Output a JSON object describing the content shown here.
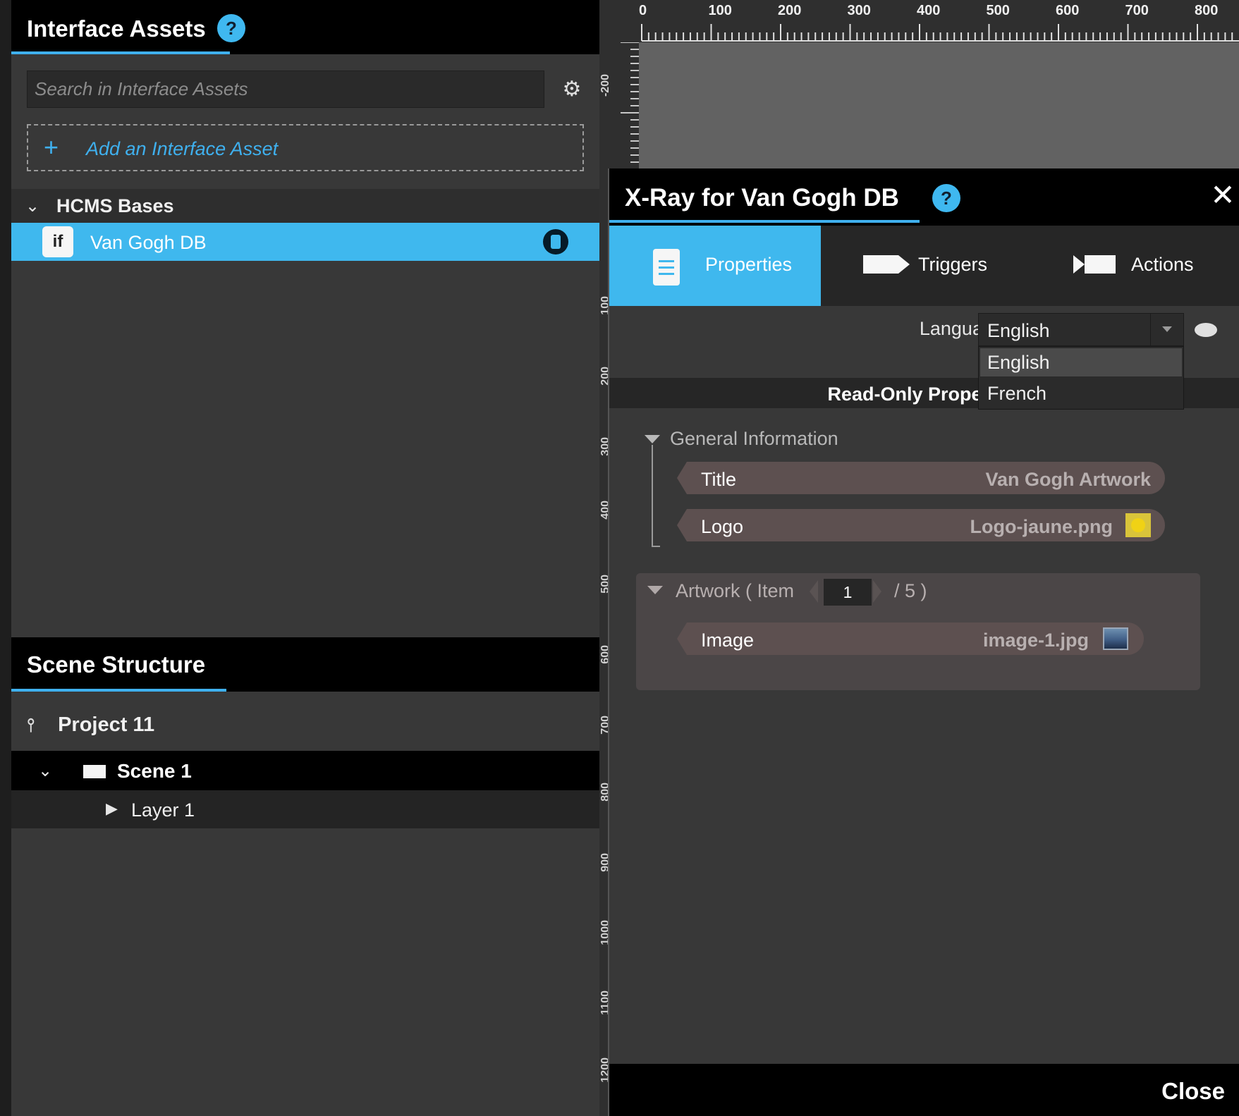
{
  "left_panel": {
    "interface_assets": {
      "title": "Interface Assets",
      "help": "?",
      "search_placeholder": "Search in Interface Assets",
      "add_label": "Add an Interface Asset",
      "add_icon": "+",
      "group": {
        "label": "HCMS Bases",
        "items": [
          {
            "label": "Van Gogh DB",
            "icon_text": "if"
          }
        ]
      }
    },
    "scene_structure": {
      "title": "Scene Structure",
      "project": "Project 11",
      "scene": "Scene 1",
      "layer": "Layer 1"
    }
  },
  "ruler": {
    "top_labels": [
      "0",
      "100",
      "200",
      "300",
      "400",
      "500",
      "600",
      "700",
      "800"
    ],
    "left_labels": [
      "-200",
      "100",
      "200",
      "300",
      "400",
      "500",
      "600",
      "700",
      "800",
      "900",
      "1000",
      "1100",
      "1200"
    ]
  },
  "xray": {
    "title": "X-Ray for Van Gogh DB",
    "help": "?",
    "close_icon": "✕",
    "tabs": [
      {
        "label": "Properties",
        "active": true
      },
      {
        "label": "Triggers",
        "active": false
      },
      {
        "label": "Actions",
        "active": false
      }
    ],
    "language": {
      "label": "Language",
      "selected": "English",
      "options": [
        "English",
        "French"
      ]
    },
    "readonly_header": "Read-Only Properties",
    "general_info": {
      "label": "General Information",
      "rows": [
        {
          "key": "Title",
          "value": "Van Gogh Artwork"
        },
        {
          "key": "Logo",
          "value": "Logo-jaune.png"
        }
      ]
    },
    "artwork": {
      "label": "Artwork  ( Item",
      "item": "1",
      "total": "/ 5 )",
      "rows": [
        {
          "key": "Image",
          "value": "image-1.jpg"
        }
      ]
    },
    "footer_close": "Close"
  },
  "colors": {
    "accent": "#3fb8ee",
    "panel": "#383838",
    "header": "#000000",
    "prop_row": "#5d5050"
  },
  "icons": {
    "gear": "gear-icon",
    "eye": "eye-icon",
    "database": "database-icon",
    "logo_swatch": "image-swatch-icon",
    "image_thumb": "image-thumbnail-icon"
  }
}
